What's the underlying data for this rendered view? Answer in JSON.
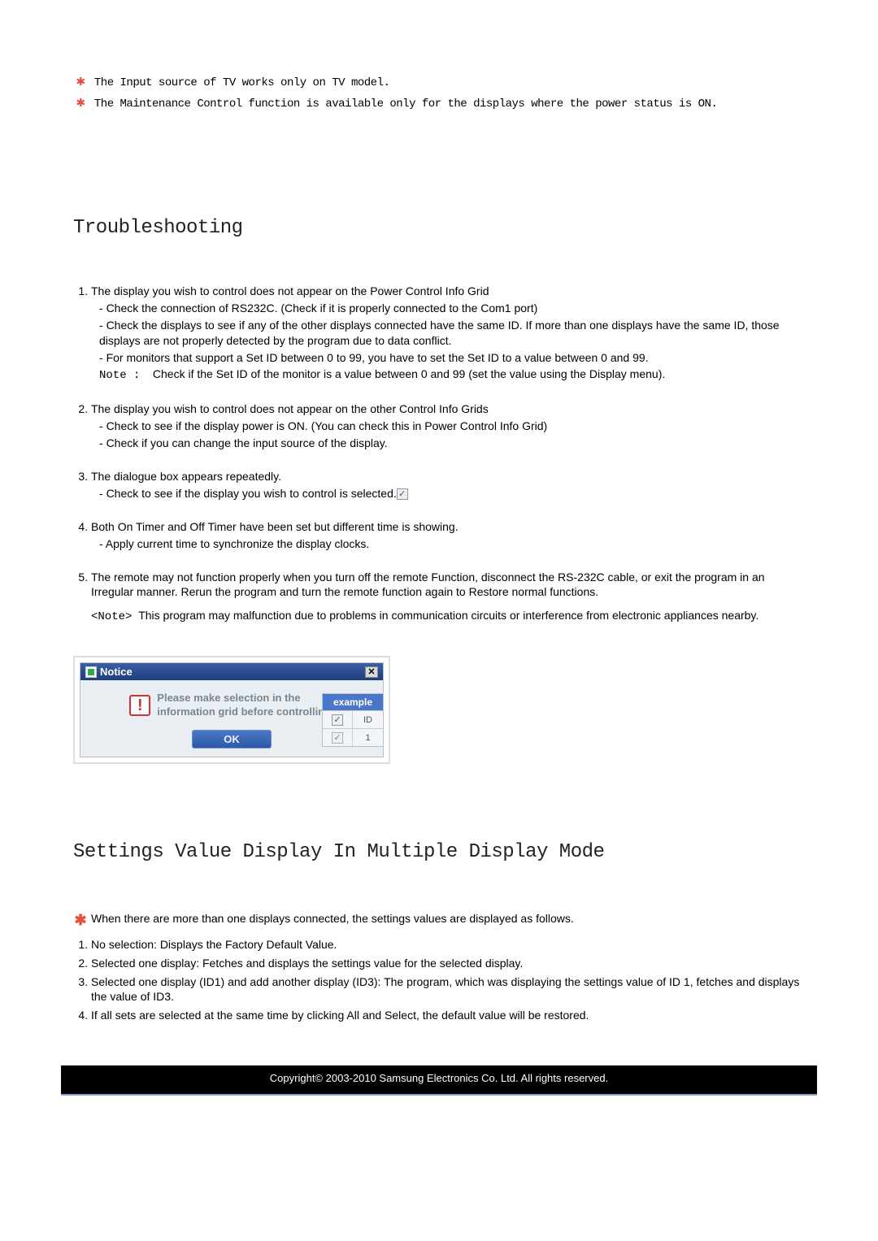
{
  "top_notes": [
    "The Input source of TV works only on TV model.",
    "The Maintenance Control function is available only for the displays where the power status is ON."
  ],
  "section1": {
    "title": "Troubleshooting",
    "items": [
      {
        "text": "The display you wish to control does not appear on the Power Control Info Grid",
        "subs": [
          "Check the connection of RS232C. (Check if it is properly connected to the Com1 port)",
          "Check the displays to see if any of the other displays connected have the same ID. If more than one displays have the same ID, those displays are not properly detected by the program due to data conflict.",
          "For monitors that support a Set ID between 0 to 99, you have to set the Set ID to a value between 0 and 99."
        ],
        "note_label": "Note :",
        "note_text": "Check if the Set ID of the monitor is a value between 0 and 99 (set the value using the Display menu)."
      },
      {
        "text": "The display you wish to control does not appear on the other Control Info Grids",
        "subs": [
          "Check to see if the display power is ON. (You can check this in Power Control Info Grid)",
          "Check if you can change the input source of the display."
        ]
      },
      {
        "text": "The dialogue box appears repeatedly.",
        "subs": [
          "Check to see if the display you wish to control is selected."
        ],
        "has_checkbox": true
      },
      {
        "text": "Both On Timer and Off Timer have been set but different time is showing.",
        "subs": [
          "Apply current time to synchronize the display clocks."
        ]
      },
      {
        "text": "The remote may not function properly when you turn off the remote Function, disconnect the RS-232C cable, or exit the program in an Irregular manner. Rerun the program and turn the remote function again to Restore normal functions.",
        "subs": [],
        "block_note_label": "<Note>",
        "block_note_text": "This program may malfunction due to problems in communication circuits or interference from electronic appliances nearby."
      }
    ]
  },
  "notice": {
    "title": "Notice",
    "message_l1": "Please make selection in the",
    "message_l2": "information grid before controlling.",
    "ok": "OK",
    "example_label": "example",
    "col1": "ID",
    "row2_col2": "1"
  },
  "section2": {
    "title": "Settings Value Display In Multiple Display Mode",
    "intro": "When there are more than one displays connected, the settings values are displayed as follows.",
    "items": [
      "No selection: Displays the Factory Default Value.",
      "Selected one display: Fetches and displays the settings value for the selected display.",
      "Selected one display (ID1) and add another display (ID3): The program, which was displaying the settings value of ID 1, fetches and displays the value of ID3.",
      "If all sets are selected at the same time by clicking All and Select, the default value will be restored."
    ]
  },
  "footer": "Copyright© 2003-2010  Samsung Electronics Co. Ltd. All rights reserved.",
  "icons": {
    "star": "✱",
    "check": "✓",
    "close": "✕",
    "exclaim": "!"
  }
}
